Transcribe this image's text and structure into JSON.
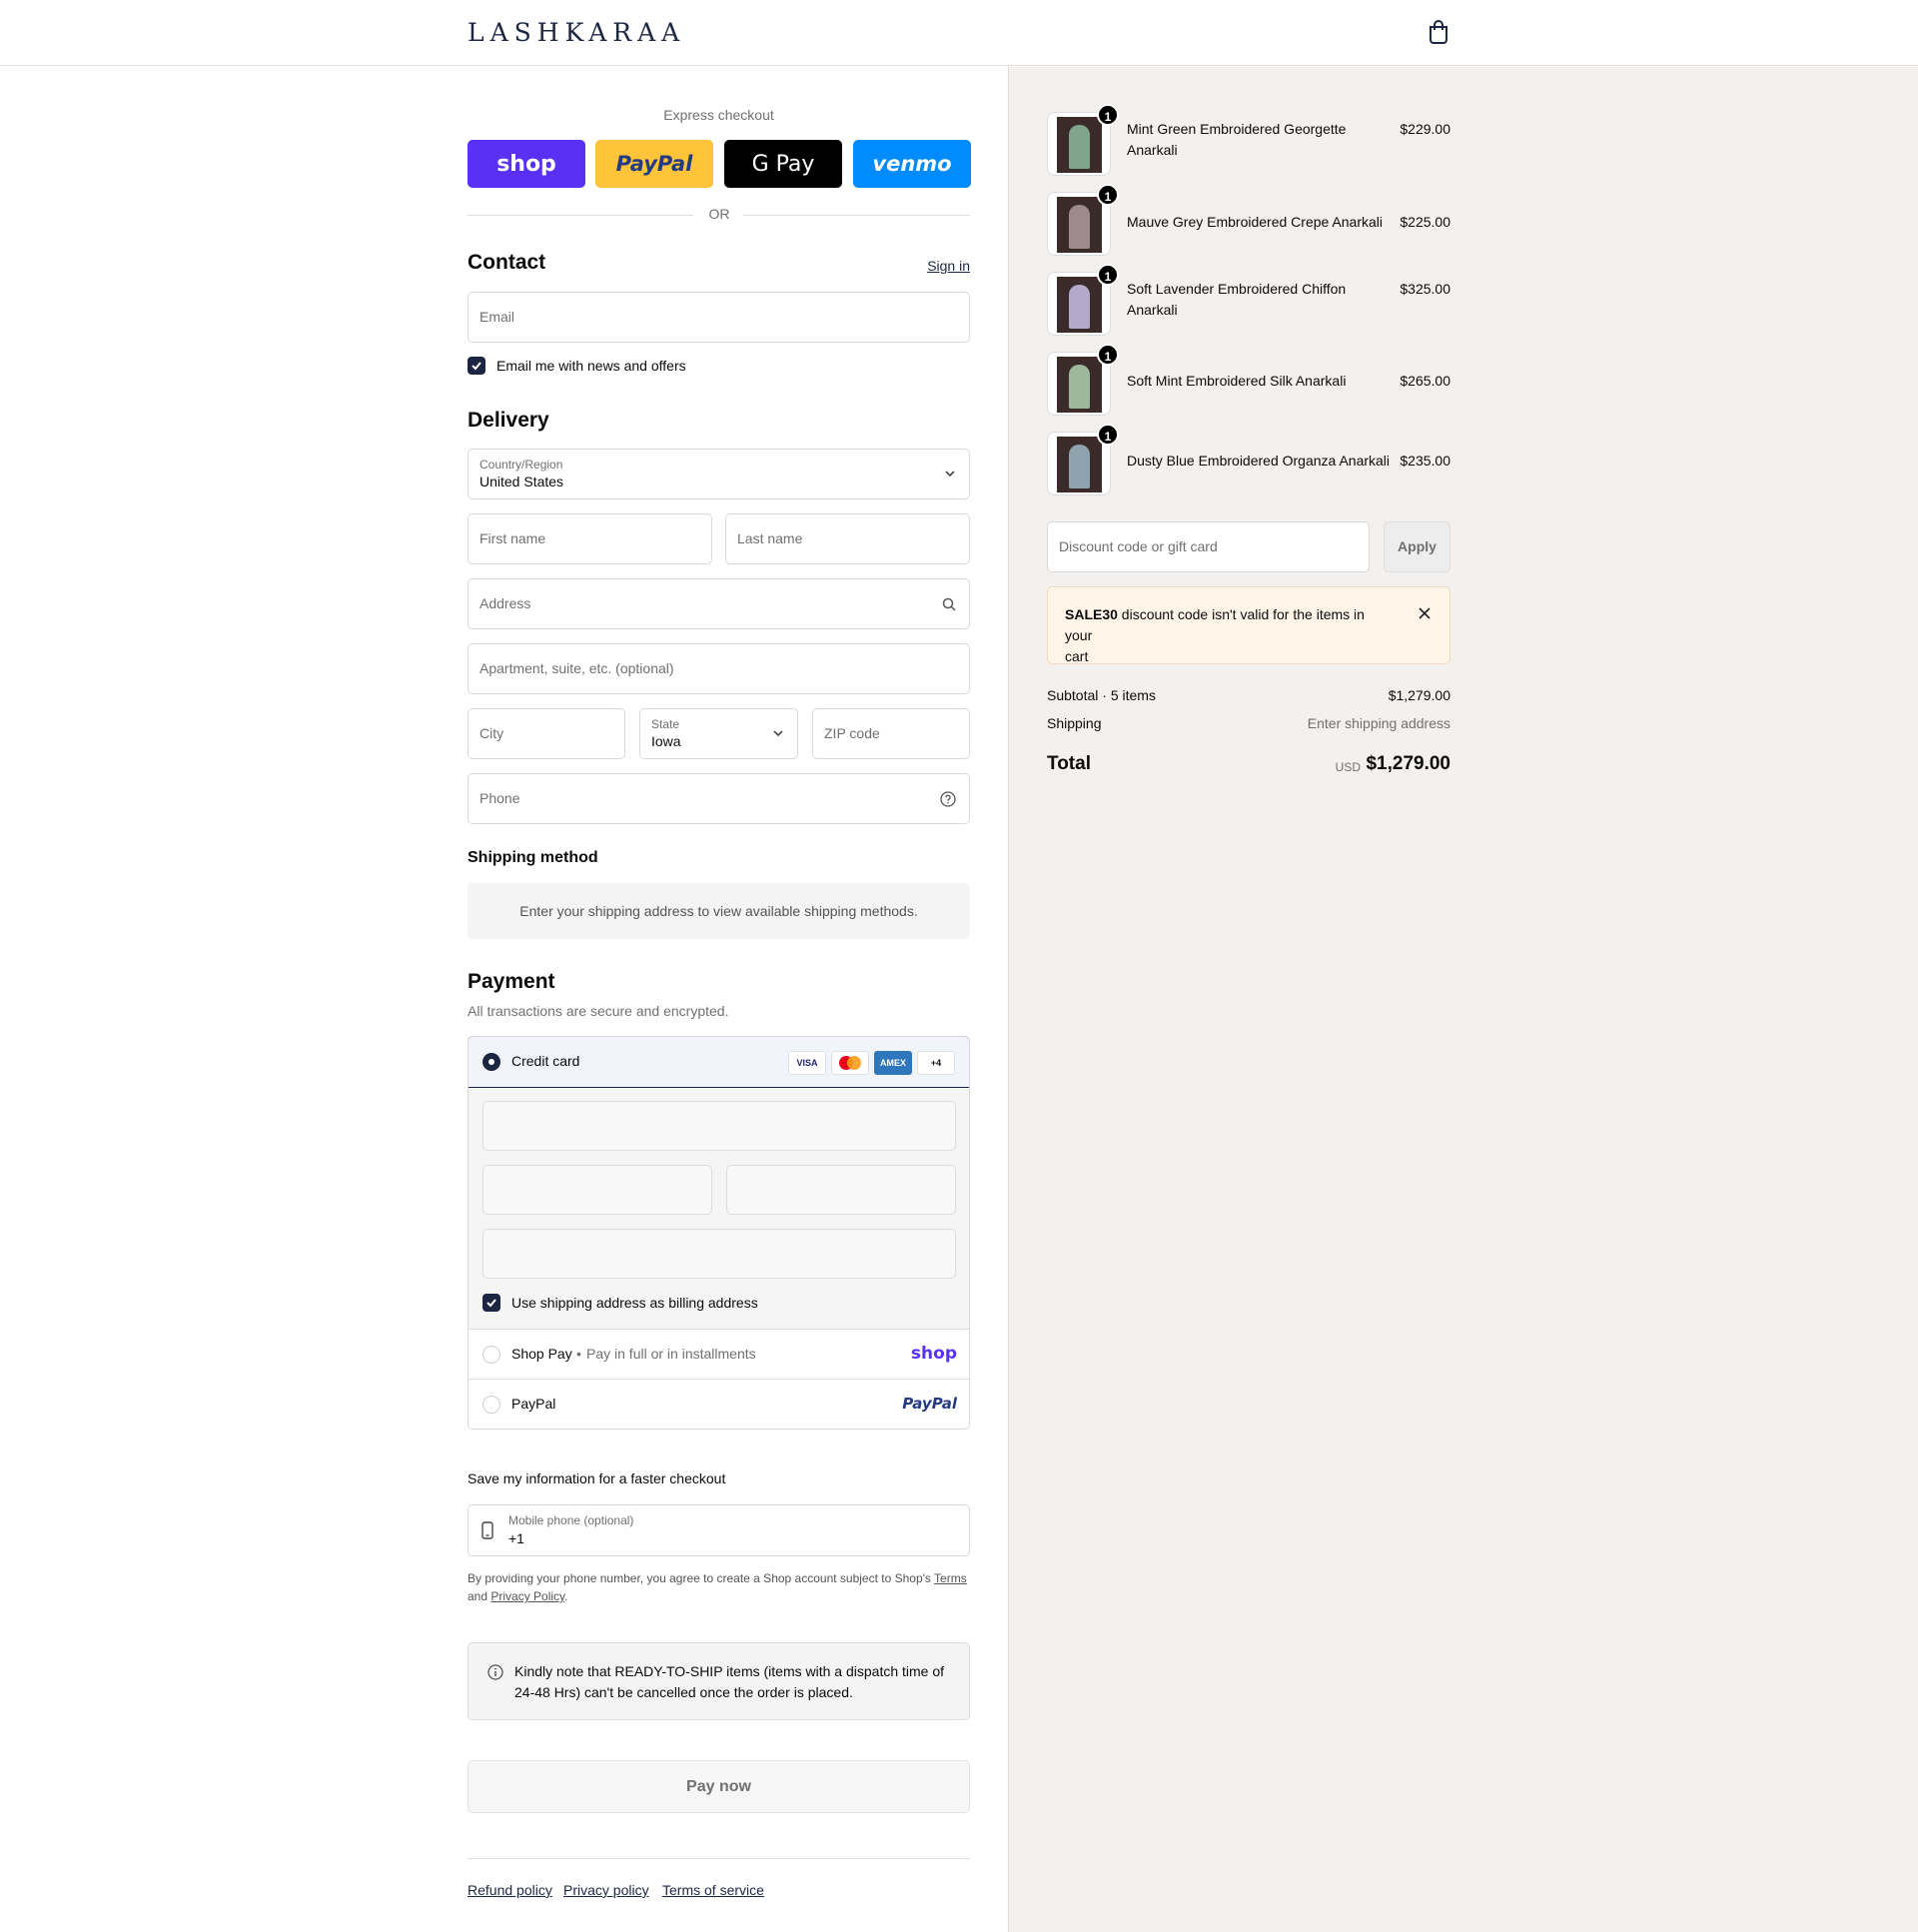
{
  "header": {
    "logo": "LASHKARAA",
    "cart_icon": "shopping-bag-icon"
  },
  "express": {
    "title": "Express checkout",
    "buttons": [
      {
        "label": "shop",
        "color": "#5a31f4",
        "text_color": "#ffffff"
      },
      {
        "label": "PayPal",
        "color": "#ffc439",
        "text_color": "#253b80"
      },
      {
        "label": "G Pay",
        "color": "#000000",
        "text_color": "#ffffff"
      },
      {
        "label": "venmo",
        "color": "#008cff",
        "text_color": "#ffffff"
      }
    ],
    "or": "OR"
  },
  "contact": {
    "title": "Contact",
    "sign_in": "Sign in",
    "email_placeholder": "Email",
    "newsletter_label": "Email me with news and offers",
    "newsletter_checked": true
  },
  "delivery": {
    "title": "Delivery",
    "country_label": "Country/Region",
    "country_value": "United States",
    "first_name_placeholder": "First name",
    "last_name_placeholder": "Last name",
    "address_placeholder": "Address",
    "apartment_placeholder": "Apartment, suite, etc. (optional)",
    "city_placeholder": "City",
    "state_label": "State",
    "state_value": "Iowa",
    "zip_placeholder": "ZIP code",
    "phone_placeholder": "Phone"
  },
  "shipping_method": {
    "title": "Shipping method",
    "info": "Enter your shipping address to view available shipping methods."
  },
  "payment": {
    "title": "Payment",
    "subtitle": "All transactions are secure and encrypted.",
    "credit_card_label": "Credit card",
    "cards": [
      "VISA",
      "MC",
      "AMEX",
      "+4"
    ],
    "billing_label": "Use shipping address as billing address",
    "billing_checked": true,
    "shop_pay_label": "Shop Pay",
    "shop_pay_sub": "Pay in full or in installments",
    "shop_pay_logo": "shop",
    "paypal_label": "PayPal",
    "paypal_logo": "PayPal"
  },
  "save_info": {
    "title": "Save my information for a faster checkout",
    "mobile_label": "Mobile phone (optional)",
    "mobile_value": "+1",
    "terms_prefix": "By providing your phone number, you agree to create a Shop account subject to Shop's",
    "terms_link": "Terms",
    "terms_and": "and",
    "privacy_link": "Privacy Policy",
    "terms_suffix": "."
  },
  "notice": {
    "line1": "Kindly note that READY-TO-SHIP items (items with a dispatch time of",
    "line2": "24-48 Hrs) can't be cancelled once the order is placed."
  },
  "pay_now": "Pay now",
  "footer": {
    "links": [
      "Refund policy",
      "Privacy policy",
      "Terms of service"
    ]
  },
  "cart": {
    "items": [
      {
        "name_line1": "Mint Green Embroidered Georgette",
        "name_line2": "Anarkali",
        "price": "$229.00",
        "qty": "1",
        "swatch": "#7fa58d"
      },
      {
        "name_line1": "Mauve Grey Embroidered Crepe Anarkali",
        "name_line2": "",
        "price": "$225.00",
        "qty": "1",
        "swatch": "#9d8a8c"
      },
      {
        "name_line1": "Soft Lavender Embroidered Chiffon",
        "name_line2": "Anarkali",
        "price": "$325.00",
        "qty": "1",
        "swatch": "#b4a9c8"
      },
      {
        "name_line1": "Soft Mint Embroidered Silk Anarkali",
        "name_line2": "",
        "price": "$265.00",
        "qty": "1",
        "swatch": "#9db89a"
      },
      {
        "name_line1": "Dusty Blue Embroidered Organza Anarkali",
        "name_line2": "",
        "price": "$235.00",
        "qty": "1",
        "swatch": "#8ea3ad"
      }
    ],
    "discount_placeholder": "Discount code or gift card",
    "apply": "Apply",
    "warning_code": "SALE30",
    "warning_text": " discount code isn't valid for the items in your",
    "warning_text2": "cart",
    "subtotal_label": "Subtotal · 5 items",
    "subtotal_value": "$1,279.00",
    "shipping_label": "Shipping",
    "shipping_value": "Enter shipping address",
    "total_label": "Total",
    "total_currency": "USD",
    "total_value": "$1,279.00"
  }
}
